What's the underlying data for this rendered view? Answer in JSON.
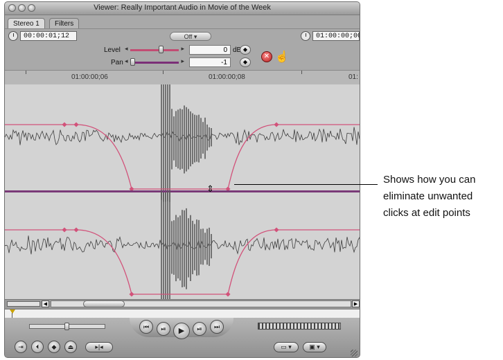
{
  "window": {
    "title": "Viewer: Really Important Audio in Movie of the Week"
  },
  "tabs": [
    {
      "label": "Stereo 1"
    },
    {
      "label": "Filters"
    }
  ],
  "timecode": {
    "duration": "00:00:01;12",
    "play_mode": "Off",
    "current": "01:00:00;00"
  },
  "controls": {
    "level": {
      "label": "Level",
      "value": "0",
      "unit": "dB",
      "fraction": 0.62
    },
    "pan": {
      "label": "Pan",
      "value": "-1",
      "fraction": 0.0
    }
  },
  "ruler": {
    "labels": [
      "01:00:00;06",
      "01:00:00;08",
      "01:"
    ]
  },
  "callout": {
    "lines": [
      "Shows how you can",
      "eliminate unwanted",
      "clicks at edit points"
    ]
  },
  "icons": {
    "window_controls": [
      "close-icon",
      "minimize-icon",
      "zoom-icon"
    ],
    "transport": [
      "jump-back-icon",
      "play-in-to-out-icon",
      "play-icon",
      "play-around-icon",
      "jump-forward-icon"
    ],
    "edit_buttons": [
      "match-frame-icon",
      "mark-in-icon",
      "add-keyframe-icon",
      "add-marker-icon",
      "mark-out-icon"
    ]
  },
  "colors": {
    "keyframe_line": "#d2527a",
    "waveform": "#3d3d3d",
    "waveform_bg": "#d3d3d3",
    "divider": "#7a3a78"
  }
}
